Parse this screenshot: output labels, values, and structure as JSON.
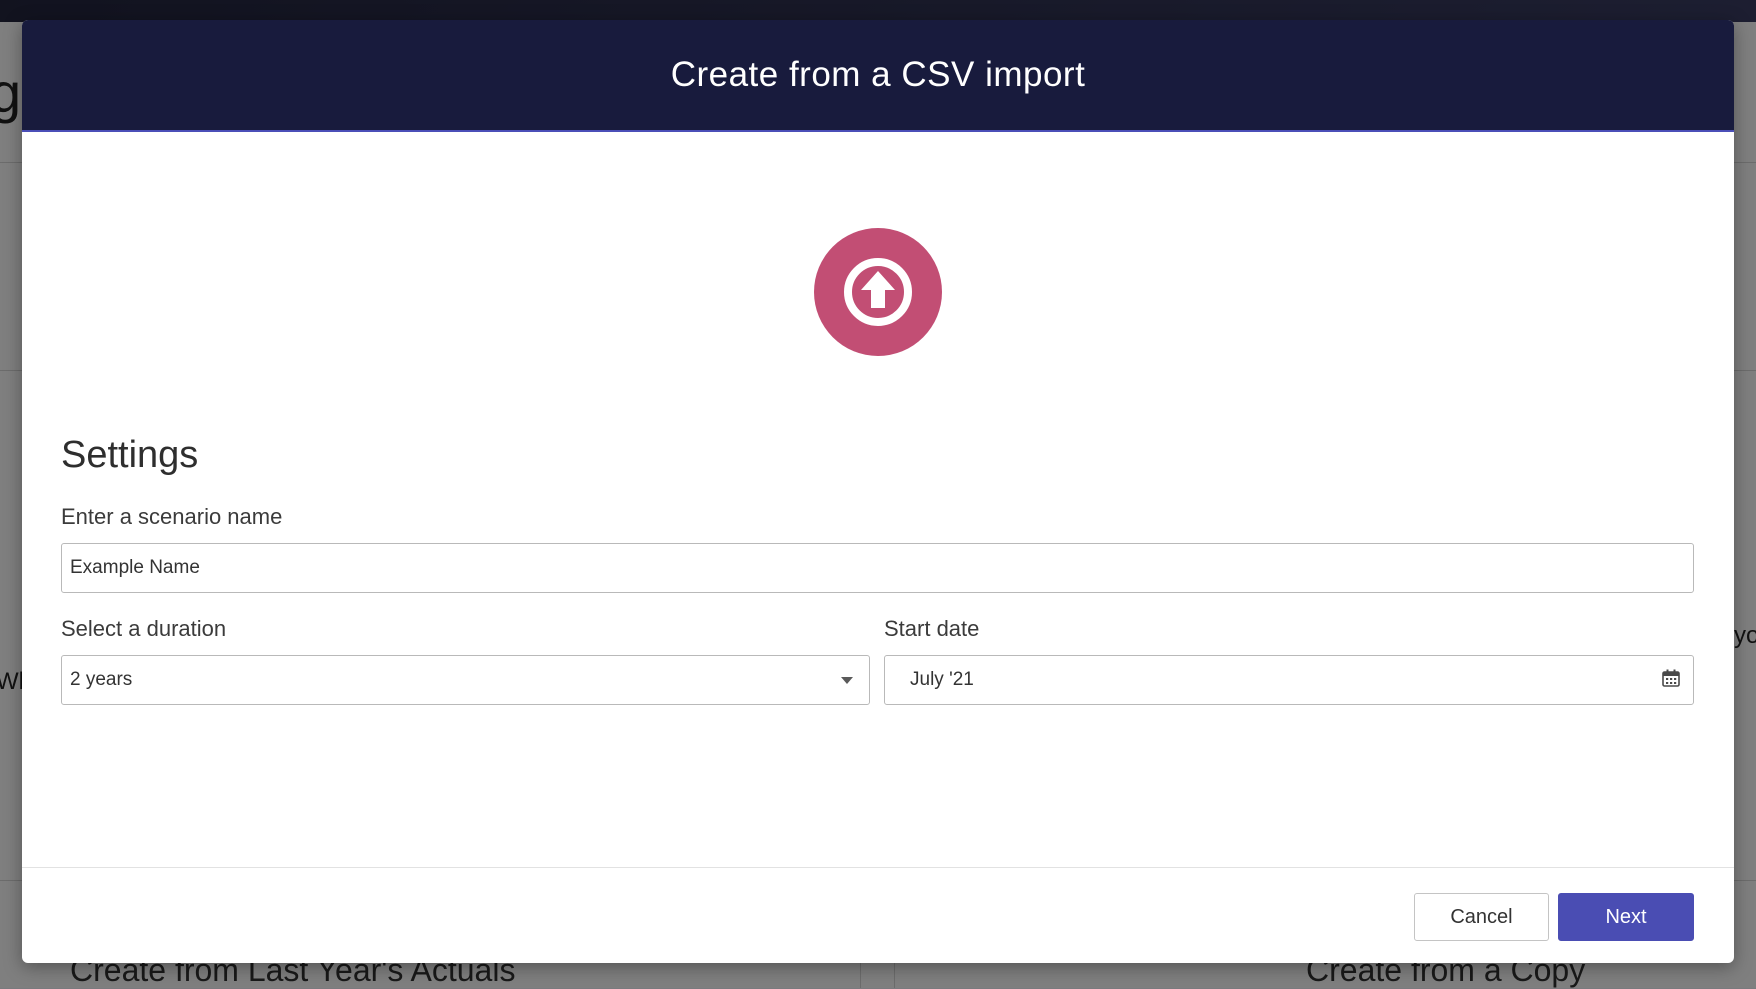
{
  "background": {
    "heading_fragment": "ge",
    "left_fragment": "Wh",
    "right_fragment": "yo",
    "card_left_title": "Create from Last Year's Actuals",
    "card_right_title": "Create from a Copy"
  },
  "modal": {
    "title": "Create from a CSV import",
    "upload_icon": "upload-arrow-circle-icon",
    "accent_color": "#c24e74",
    "header_color": "#181b3d",
    "settings": {
      "heading": "Settings",
      "name_label": "Enter a scenario name",
      "name_value": "Example Name",
      "duration_label": "Select a duration",
      "duration_value": "2 years",
      "start_label": "Start date",
      "start_value": "July '21"
    },
    "footer": {
      "cancel_label": "Cancel",
      "next_label": "Next",
      "primary_color": "#4a4db3"
    }
  }
}
